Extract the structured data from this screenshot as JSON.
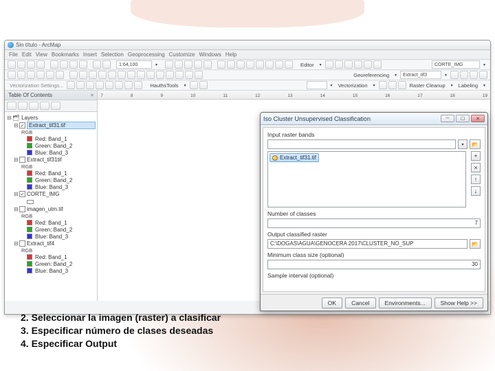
{
  "app_title": "Sin título - ArcMap",
  "menu": [
    "File",
    "Edit",
    "View",
    "Bookmarks",
    "Insert",
    "Selection",
    "Geoprocessing",
    "Customize",
    "Windows",
    "Help"
  ],
  "scale_value": "1:64,100",
  "editor_label": "Editor",
  "georeferencing_label": "Georeferencing",
  "georef_layer": "Extract_tif3",
  "corte_label": "CORTE_IMG",
  "hauths_label": "HauthsTools",
  "vectorization_label": "Vectorization",
  "raster_cleanup_label": "Raster Cleanup",
  "labeling_label": "Labeling",
  "toc": {
    "title": "Table Of Contents",
    "root": "Layers",
    "layers": [
      {
        "name": "Extract_tif31.tif",
        "checked": true,
        "selected": true,
        "bands": [
          "Red: Band_1",
          "Green: Band_2",
          "Blue: Band_3"
        ]
      },
      {
        "name": "Extract_tif31tif",
        "checked": false,
        "bands": [
          "Red: Band_1",
          "Green: Band_2",
          "Blue: Band_3"
        ]
      },
      {
        "name": "CORTE_IMG",
        "checked": true,
        "sub": ""
      },
      {
        "name": "imagen_utm.tif",
        "checked": false,
        "bands": [
          "Red: Band_1",
          "Green: Band_2",
          "Blue: Band_3"
        ]
      },
      {
        "name": "Extract_tif4",
        "checked": false,
        "bands": [
          "Red: Band_1",
          "Green: Band_2",
          "Blue: Band_3"
        ]
      }
    ],
    "rgb_label": "RGB"
  },
  "ruler_marks": [
    "7",
    "8",
    "9",
    "10",
    "11",
    "12",
    "13",
    "14",
    "15",
    "16",
    "17",
    "18",
    "19"
  ],
  "dialog": {
    "title": "Iso Cluster Unsupervised Classification",
    "input_bands_label": "Input raster bands",
    "input_bands_value": "Extract_tif31.tif",
    "num_classes_label": "Number of classes",
    "num_classes_value": "7",
    "output_label": "Output classified raster",
    "output_value": "C:\\DOGAS\\AGUA\\GENOCERA 2017\\CLUSTER_NO_SUP",
    "min_class_label": "Minimum class size (optional)",
    "min_class_value": "30",
    "sample_interval_label": "Sample interval (optional)",
    "buttons": {
      "ok": "OK",
      "cancel": "Cancel",
      "env": "Environments...",
      "help": "Show Help >>"
    }
  },
  "caption": {
    "l1": "2. Seleccionar la imagen (raster) a clasificar",
    "l2": "3. Especificar número de clases deseadas",
    "l3": "4. Especificar Output"
  }
}
